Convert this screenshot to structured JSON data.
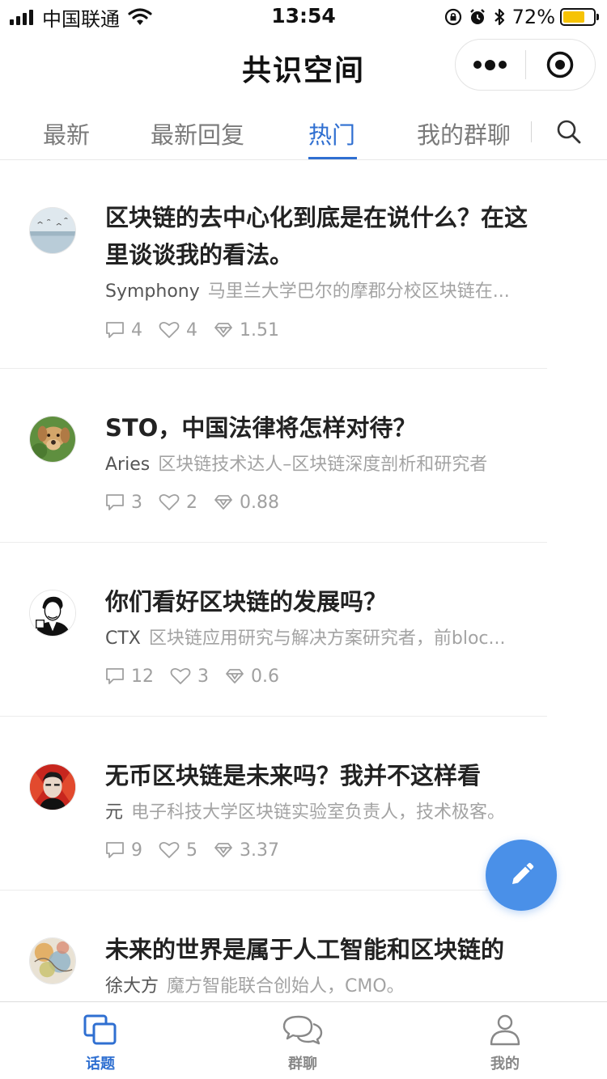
{
  "status_bar": {
    "carrier": "中国联通",
    "time": "13:54",
    "battery_percent": "72%",
    "battery_level": 0.72,
    "battery_color": "#f6c304",
    "icons": [
      "signal-icon",
      "wifi-icon",
      "orientation-lock-icon",
      "alarm-icon",
      "bluetooth-icon",
      "battery-icon"
    ]
  },
  "nav": {
    "title": "共识空间",
    "icons": [
      "more-icon",
      "close-miniprogram-icon"
    ]
  },
  "tabs": {
    "items": [
      "最新",
      "最新回复",
      "热门",
      "我的群聊"
    ],
    "active": "热门",
    "accent": "#2f6fd1"
  },
  "posts": [
    {
      "title": "区块链的去中心化到底是在说什么？在这里谈谈我的看法。",
      "author": "Symphony",
      "bio": "马里兰大学巴尔的摩郡分校区块链在...",
      "comments": "4",
      "likes": "4",
      "value": "1.51"
    },
    {
      "title": "STO，中国法律将怎样对待？",
      "author": "Aries",
      "bio": "区块链技术达人–区块链深度剖析和研究者",
      "comments": "3",
      "likes": "2",
      "value": "0.88"
    },
    {
      "title": "你们看好区块链的发展吗？",
      "author": "CTX",
      "bio": "区块链应用研究与解决方案研究者，前bloc...",
      "comments": "12",
      "likes": "3",
      "value": "0.6"
    },
    {
      "title": "无币区块链是未来吗？我并不这样看",
      "author": "元",
      "bio": "电子科技大学区块链实验室负责人，技术极客。",
      "comments": "9",
      "likes": "5",
      "value": "3.37"
    },
    {
      "title": "未来的世界是属于人工智能和区块链的",
      "author": "徐大方",
      "bio": "魔方智能联合创始人，CMO。",
      "comments": "",
      "likes": "",
      "value": ""
    }
  ],
  "fab": {
    "icon": "pencil-icon",
    "color": "#4a90e8"
  },
  "tabbar": {
    "items": [
      {
        "label": "话题",
        "icon": "topics-icon",
        "active": true
      },
      {
        "label": "群聊",
        "icon": "group-chat-icon",
        "active": false
      },
      {
        "label": "我的",
        "icon": "profile-icon",
        "active": false
      }
    ]
  }
}
